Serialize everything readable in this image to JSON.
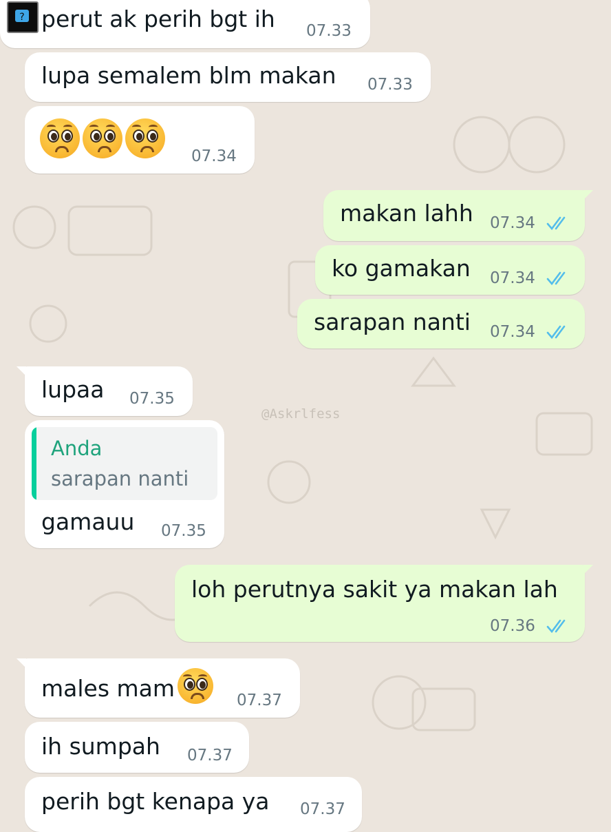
{
  "chat": {
    "watermark": "@Askrlfess",
    "messages": [
      {
        "text": "perut ak perih bgt ih",
        "time": "07.33"
      },
      {
        "text": "lupa semalem blm makan",
        "time": "07.33"
      },
      {
        "text": "",
        "time": "07.34",
        "emoji": "pleading-face x3"
      },
      {
        "text": "makan lahh",
        "time": "07.34",
        "status": "read"
      },
      {
        "text": "ko gamakan",
        "time": "07.34",
        "status": "read"
      },
      {
        "text": "sarapan nanti",
        "time": "07.34",
        "status": "read"
      },
      {
        "text": "lupaa",
        "time": "07.35"
      },
      {
        "text": "gamauu",
        "time": "07.35",
        "quote": {
          "author": "Anda",
          "text": "sarapan nanti"
        }
      },
      {
        "text": "loh perutnya sakit ya makan lah",
        "time": "07.36",
        "status": "read"
      },
      {
        "text": "males mam",
        "time": "07.37",
        "emoji": "pleading-face"
      },
      {
        "text": "ih sumpah",
        "time": "07.37"
      },
      {
        "text": "perih bgt kenapa ya",
        "time": "07.37"
      }
    ]
  },
  "colors": {
    "wallpaper": "#ece5dd",
    "incoming_bubble": "#ffffff",
    "outgoing_bubble": "#e7fdd4",
    "read_ticks": "#53bdeb",
    "quote_accent": "#06cf9c"
  }
}
